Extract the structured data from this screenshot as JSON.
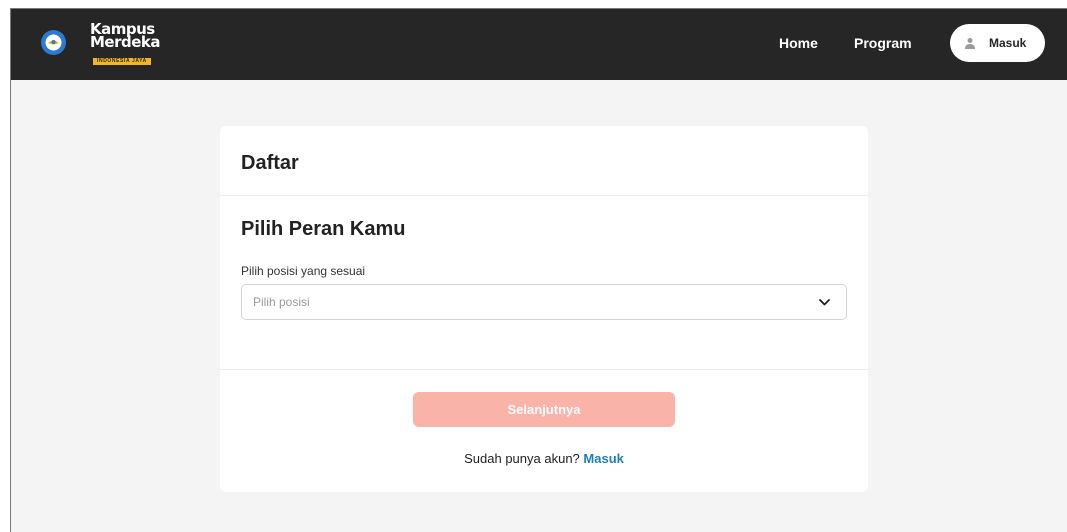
{
  "header": {
    "logo": {
      "line1": "Kampus",
      "line2": "Merdeka",
      "tag": "INDONESIA JAYA"
    },
    "nav": {
      "home": "Home",
      "program": "Program"
    },
    "login_button": "Masuk"
  },
  "card": {
    "title": "Daftar",
    "section_title": "Pilih Peran Kamu",
    "field_label": "Pilih posisi yang sesuai",
    "select_placeholder": "Pilih posisi",
    "next_button": "Selanjutnya",
    "have_account_text": "Sudah punya akun?",
    "login_link": "Masuk"
  },
  "colors": {
    "navbar_bg": "#262626",
    "page_bg": "#f4f4f5",
    "next_button_disabled": "#f9b3a8",
    "link": "#1f7fb6"
  }
}
